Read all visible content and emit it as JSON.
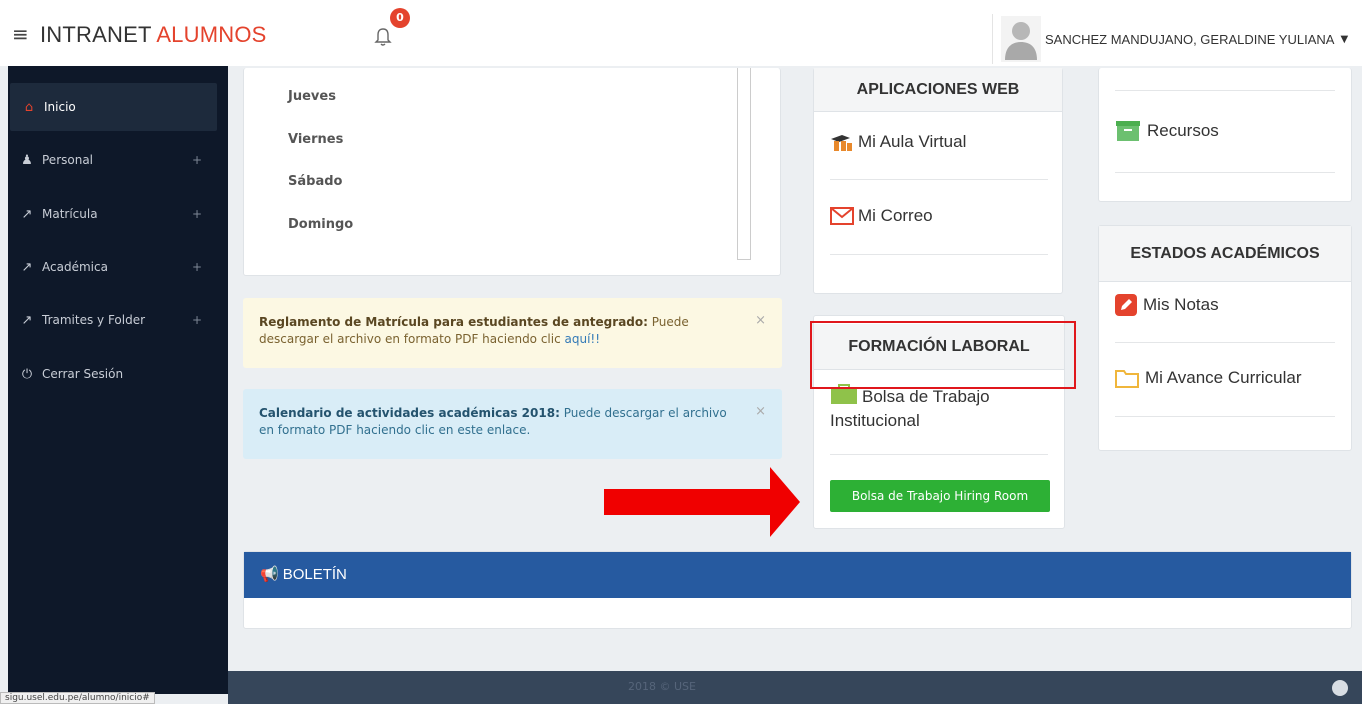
{
  "header": {
    "brand_main": "INTRANET",
    "brand_accent": "ALUMNOS",
    "notifications_count": "0",
    "user_name": "SANCHEZ MANDUJANO, GERALDINE YULIANA"
  },
  "sidebar": {
    "items": [
      {
        "label": "Inicio",
        "icon": "home-icon",
        "active": true
      },
      {
        "label": "Personal",
        "icon": "user-icon",
        "expand": "+"
      },
      {
        "label": "Matrícula",
        "icon": "external-link-icon",
        "expand": "+"
      },
      {
        "label": "Académica",
        "icon": "external-link-icon",
        "expand": "+"
      },
      {
        "label": "Tramites y Folder",
        "icon": "external-link-icon",
        "expand": "+"
      },
      {
        "label": "Cerrar Sesión",
        "icon": "power-icon"
      }
    ]
  },
  "schedule": {
    "days": [
      "Jueves",
      "Viernes",
      "Sábado",
      "Domingo"
    ]
  },
  "alerts": {
    "warning": {
      "title": "Reglamento de Matrícula para estudiantes de antegrado:",
      "text": " Puede descargar el archivo en formato PDF haciendo clic ",
      "link": "aquí!!",
      "close": "×"
    },
    "info": {
      "title": "Calendario de actividades académicas 2018:",
      "text": " Puede descargar el archivo en formato PDF haciendo clic en este enlace.",
      "close": "×"
    }
  },
  "apps": {
    "title": "APLICACIONES WEB",
    "aula_virtual": "Mi Aula Virtual",
    "correo": "Mi Correo"
  },
  "formacion": {
    "title": "FORMACIÓN LABORAL",
    "bolsa": "Bolsa de Trabajo Institucional",
    "hiring_button": "Bolsa de Trabajo Hiring Room"
  },
  "recursos": {
    "label": "Recursos"
  },
  "estados": {
    "title": "ESTADOS ACADÉMICOS",
    "notas": "Mis Notas",
    "avance": "Mi Avance Curricular"
  },
  "boletin": {
    "title": "BOLETÍN"
  },
  "footer": {
    "text": "2018 © USE"
  },
  "status_url": "sigu.usel.edu.pe/alumno/inicio#",
  "colors": {
    "accent": "#e4432d",
    "sidebar_bg": "#0e1829",
    "boletin_bg": "#265aa0",
    "button_green": "#2db035",
    "highlight_red": "#e0171c"
  }
}
